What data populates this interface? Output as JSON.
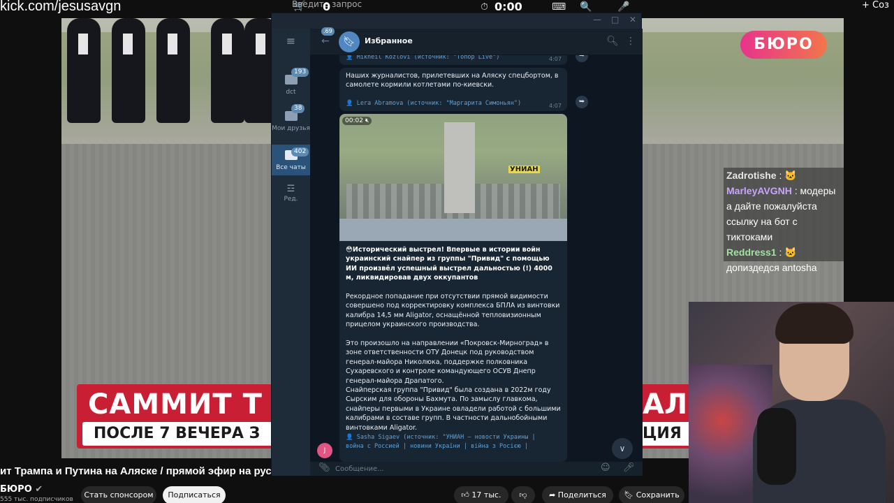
{
  "topbar": {
    "stream_url": "kick.com/jesusavgn",
    "search_placeholder": "Введите запрос",
    "counter": "0",
    "timer": "0:00",
    "create_label": "Соз"
  },
  "video_overlay": {
    "brand": "БЮРО",
    "banner_main": "САММИТ Т",
    "banner_sub": "ПОСЛЕ 7 ВЕЧЕРА З",
    "banner_main_right": "АЛ",
    "banner_sub_right": "ЦИЯ"
  },
  "chat": [
    {
      "user": "Zadrotishe",
      "text": ": 🐱",
      "color": "#e6e6e6"
    },
    {
      "user": "MarleyAVGNH",
      "text": ": модеры а дайте пожалуйста ссылку на бот с тиктоками",
      "color": "#c7a6ff"
    },
    {
      "user": "Reddress1",
      "text": ": 🐱 допиздедся antosha",
      "color": "#9fe3a2"
    }
  ],
  "youtube": {
    "title": "ит Трампа и Путина на Аляске / прямой эфир на русск",
    "channel": "БЮРО",
    "subscribers": "555 тыс. подписчиков",
    "sponsor_label": "Стать спонсором",
    "subscribe_label": "Подписаться",
    "likes": "17 тыс.",
    "share_label": "Поделиться",
    "save_label": "Сохранить"
  },
  "telegram": {
    "chat_title": "Избранное",
    "back_badge": "69",
    "sidebar": [
      {
        "label": "dct",
        "badge": "193"
      },
      {
        "label": "Мои друзья",
        "badge": "38"
      },
      {
        "label": "Все чаты",
        "badge": "402"
      },
      {
        "label": "Ред.",
        "badge": ""
      }
    ],
    "messages": [
      {
        "signature": "👤 Mikheil Kozlovi (источник: \"Топор Live\")",
        "time": "4:07"
      },
      {
        "text": "Наших журналистов, прилетевших на Аляску спецбортом, в самолете кормили котлетами по-киевски.",
        "signature": "👤 Lera Abramova (источник: \"Маргарита Симоньян\")",
        "time": "4:07"
      },
      {
        "video_duration": "00:02",
        "video_watermark": "УНИАН",
        "headline": "😳Исторический выстрел! Впервые в истории войн украинский снайпер из группы \"Привид\" с помощью ИИ произвёл успешный выстрел дальностью (!) 4000 м, ликвидировав двух оккупантов",
        "p1": "Рекордное попадание при отсутствии прямой видимости совершено под корректировку комплекса БПЛА из винтовки калибра 14,5 мм Aligator, оснащённой тепловизионным прицелом украинского производства.",
        "p2": "Это произошло на направлении «Покровск-Мирноград» в зоне ответственности ОТУ Донецк под руководством генерал-майора Николюка, поддержке полковника Сухаревского и контроле командующего ОСУВ Днепр генерал-майора Драпатого.",
        "p3": "Снайперская группа \"Привид\" была создана в 2022м году Сырским для обороны Бахмута. По замыслу главкома, снайперы первыми в Украине овладели работой с большими калибрами в составе групп. В частности дальнобойными винтовками Aligator.",
        "signature_line1": "👤 Sasha Sigaev (источник: \"УНИАН — новости Украины |",
        "signature_line2": "война с Россией | новини України | війна з Росією |"
      }
    ],
    "sender_initial": "J",
    "input_placeholder": "Сообщение..."
  }
}
